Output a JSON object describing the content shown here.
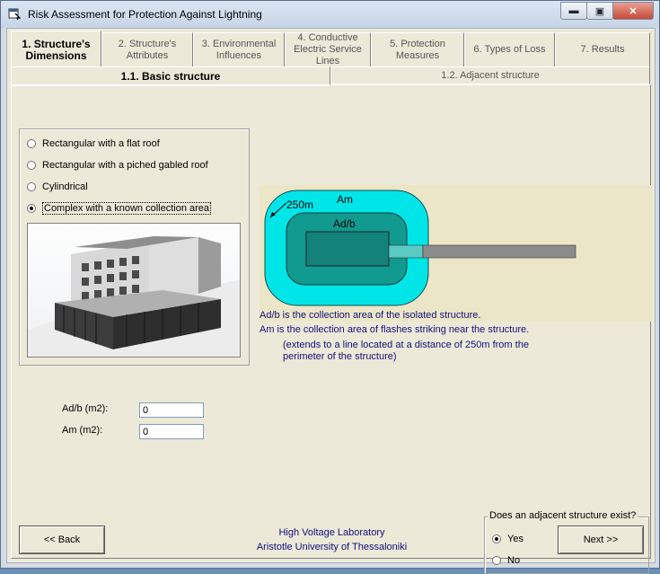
{
  "window": {
    "title": "Risk Assessment for Protection Against Lightning",
    "buttons": {
      "minimize": "▬",
      "maximize": "▣",
      "close": "✕"
    }
  },
  "main_tabs": [
    {
      "label": "1. Structure's\nDimensions",
      "active": true
    },
    {
      "label": "2. Structure's\nAttributes",
      "active": false
    },
    {
      "label": "3. Environmental\nInfluences",
      "active": false
    },
    {
      "label": "4. Conductive\nElectric Service\nLines",
      "active": false
    },
    {
      "label": "5. Protection\nMeasures",
      "active": false
    },
    {
      "label": "6. Types of Loss",
      "active": false
    },
    {
      "label": "7. Results",
      "active": false
    }
  ],
  "sub_tabs": [
    {
      "label": "1.1. Basic structure",
      "active": true
    },
    {
      "label": "1.2. Adjacent structure",
      "active": false
    }
  ],
  "structure_type": {
    "options": [
      {
        "label": "Rectangular with a flat roof",
        "checked": false
      },
      {
        "label": "Rectangular with a piched gabled roof",
        "checked": false
      },
      {
        "label": "Cylindrical",
        "checked": false
      },
      {
        "label": "Complex with a known collection area",
        "checked": true
      }
    ]
  },
  "fields": {
    "adb_label": "Ad/b (m2):",
    "adb_value": "0",
    "am_label": "Am (m2):",
    "am_value": "0"
  },
  "diagram": {
    "distance_label": "250m",
    "am_label": "Am",
    "adb_label": "Ad/b"
  },
  "info": {
    "line1": "Ad/b is the collection area of the isolated structure.",
    "line2": "Am    is the collection area of flashes striking near the structure.",
    "line3": "(extends to a line located at a distance of 250m from the",
    "line4": "perimeter of the structure)"
  },
  "adjacent": {
    "question": "Does an adjacent structure exist?",
    "yes_label": "Yes",
    "no_label": "No",
    "selected": "Yes"
  },
  "footer": {
    "lab": "High Voltage Laboratory",
    "university": "Aristotle University of Thessaloniki"
  },
  "nav": {
    "back_label": "<< Back",
    "next_label": "Next >>"
  },
  "colors": {
    "am_zone": "#00e5e8",
    "adb_zone": "#119a8f",
    "building": "#13827a",
    "line": "#8c8c8c",
    "info_text": "#10107a"
  }
}
